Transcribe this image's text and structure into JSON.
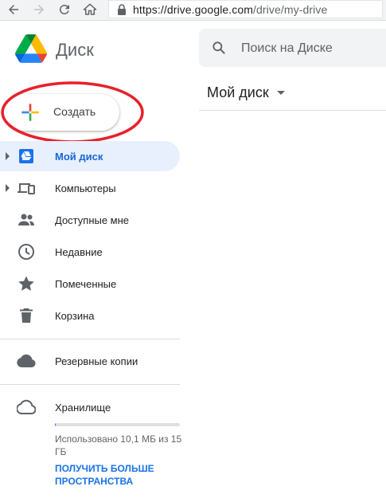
{
  "browser": {
    "url_scheme": "https://",
    "url_host": "drive.google.com",
    "url_path": "/drive/my-drive"
  },
  "header": {
    "brand": "Диск",
    "search_placeholder": "Поиск на Диске"
  },
  "main": {
    "title": "Мой диск"
  },
  "create": {
    "label": "Создать"
  },
  "sidebar": {
    "items": [
      {
        "label": "Мой диск",
        "icon": "drive-folder-icon",
        "active": true
      },
      {
        "label": "Компьютеры",
        "icon": "computers-icon"
      },
      {
        "label": "Доступные мне",
        "icon": "people-icon"
      },
      {
        "label": "Недавние",
        "icon": "clock-icon"
      },
      {
        "label": "Помеченные",
        "icon": "star-icon"
      },
      {
        "label": "Корзина",
        "icon": "trash-icon"
      },
      {
        "label": "Резервные копии",
        "icon": "cloud-filled-icon"
      },
      {
        "label": "Хранилище",
        "icon": "cloud-outline-icon"
      }
    ]
  },
  "storage": {
    "used_text": "Использовано 10,1 МБ из 15 ГБ",
    "used_fraction": 0.001,
    "upgrade_link": "ПОЛУЧИТЬ БОЛЬШЕ ПРОСТРАНСТВА"
  },
  "colors": {
    "accent": "#1a73e8",
    "active_bg": "#e8f0fe",
    "annotation": "#e8202a"
  }
}
